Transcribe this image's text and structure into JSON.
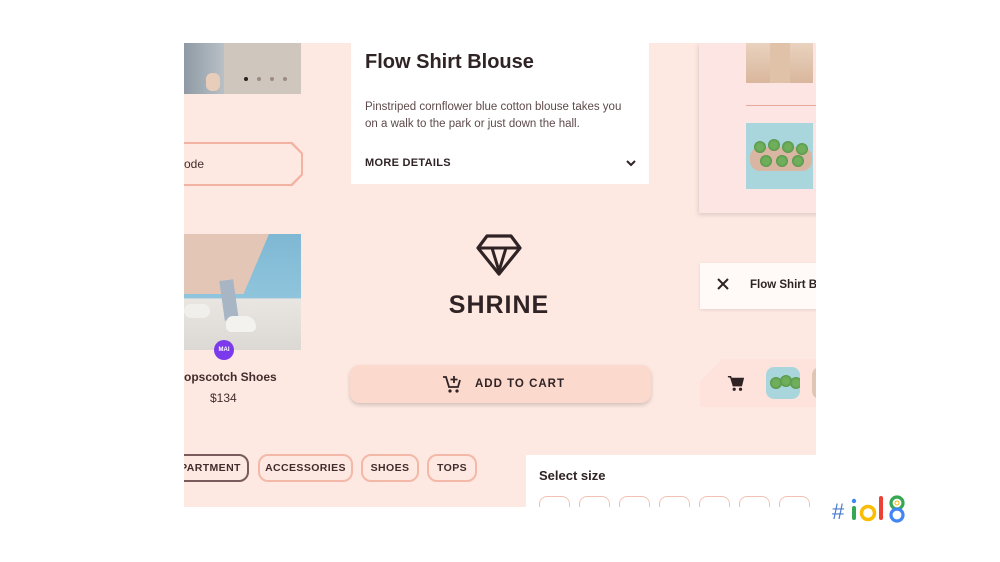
{
  "carousel": {
    "dots": [
      true,
      false,
      false,
      false
    ]
  },
  "code_field": {
    "value": "ode"
  },
  "product": {
    "name": "opscotch Shoes",
    "price": "$134",
    "badge": "MAI"
  },
  "description_card": {
    "title": "Flow Shirt Blouse",
    "body": "Pinstriped cornflower blue cotton blouse takes you on a walk to the park or just down the hall.",
    "more_details": "MORE DETAILS"
  },
  "brand": {
    "name": "SHRINE"
  },
  "chip": {
    "label": "Flow Shirt B"
  },
  "cart_button": {
    "label": "ADD TO CART"
  },
  "categories": [
    {
      "label": "PARTMENT",
      "active": true
    },
    {
      "label": "ACCESSORIES",
      "active": false
    },
    {
      "label": "SHOES",
      "active": false
    },
    {
      "label": "TOPS",
      "active": false
    }
  ],
  "size_selector": {
    "title": "Select size",
    "options_visible": 7
  },
  "event_tag": {
    "hash": "#",
    "text": "io18"
  },
  "colors": {
    "background": "#fde9e1",
    "accent": "#fcd9cd",
    "border": "#f4b8a8",
    "text": "#442c2e"
  }
}
